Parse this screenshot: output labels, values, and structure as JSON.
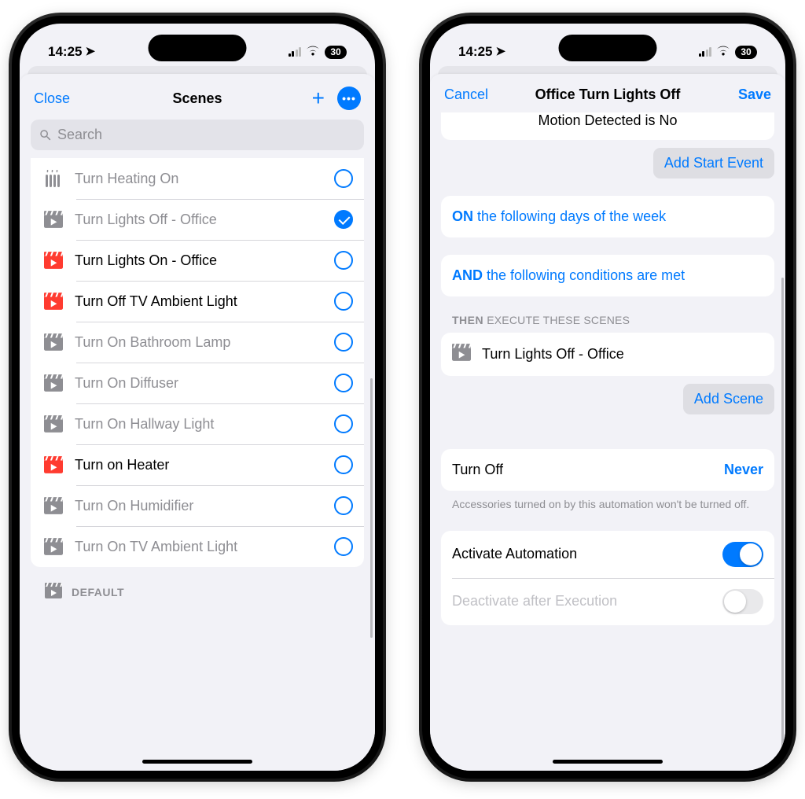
{
  "status": {
    "time": "14:25",
    "battery_pct": "30"
  },
  "left": {
    "nav": {
      "close": "Close",
      "title": "Scenes"
    },
    "search": {
      "placeholder": "Search"
    },
    "scenes": [
      {
        "label": "Turn Heating On",
        "icon": "heater",
        "dim": true,
        "checked": false,
        "bold": false
      },
      {
        "label": "Turn Lights Off - Office",
        "icon": "clapper-gray",
        "dim": true,
        "checked": true,
        "bold": false
      },
      {
        "label": "Turn Lights On - Office",
        "icon": "clapper-red",
        "dim": false,
        "checked": false,
        "bold": true
      },
      {
        "label": "Turn Off TV Ambient Light",
        "icon": "clapper-red",
        "dim": false,
        "checked": false,
        "bold": true
      },
      {
        "label": "Turn On Bathroom Lamp",
        "icon": "clapper-gray",
        "dim": true,
        "checked": false,
        "bold": false
      },
      {
        "label": "Turn On Diffuser",
        "icon": "clapper-gray",
        "dim": true,
        "checked": false,
        "bold": false
      },
      {
        "label": "Turn On Hallway Light",
        "icon": "clapper-gray",
        "dim": true,
        "checked": false,
        "bold": false
      },
      {
        "label": "Turn on Heater",
        "icon": "clapper-red",
        "dim": false,
        "checked": false,
        "bold": true
      },
      {
        "label": "Turn On Humidifier",
        "icon": "clapper-gray",
        "dim": true,
        "checked": false,
        "bold": false
      },
      {
        "label": "Turn On TV Ambient Light",
        "icon": "clapper-gray",
        "dim": true,
        "checked": false,
        "bold": false
      }
    ],
    "footer_label": "DEFAULT"
  },
  "right": {
    "nav": {
      "cancel": "Cancel",
      "title": "Office Turn Lights Off",
      "save": "Save"
    },
    "motion_line": "Motion Detected is No",
    "add_start_event": "Add Start Event",
    "on_prefix": "ON",
    "on_text": "the following days of the week",
    "and_prefix": "AND",
    "and_text": "the following conditions are met",
    "then_prefix": "THEN",
    "then_suffix": "EXECUTE THESE SCENES",
    "scene_label": "Turn Lights Off - Office",
    "add_scene": "Add Scene",
    "turn_off_label": "Turn Off",
    "turn_off_value": "Never",
    "turn_off_hint": "Accessories turned on by this automation won't be turned off.",
    "activate_label": "Activate Automation",
    "deactivate_label": "Deactivate after Execution"
  }
}
